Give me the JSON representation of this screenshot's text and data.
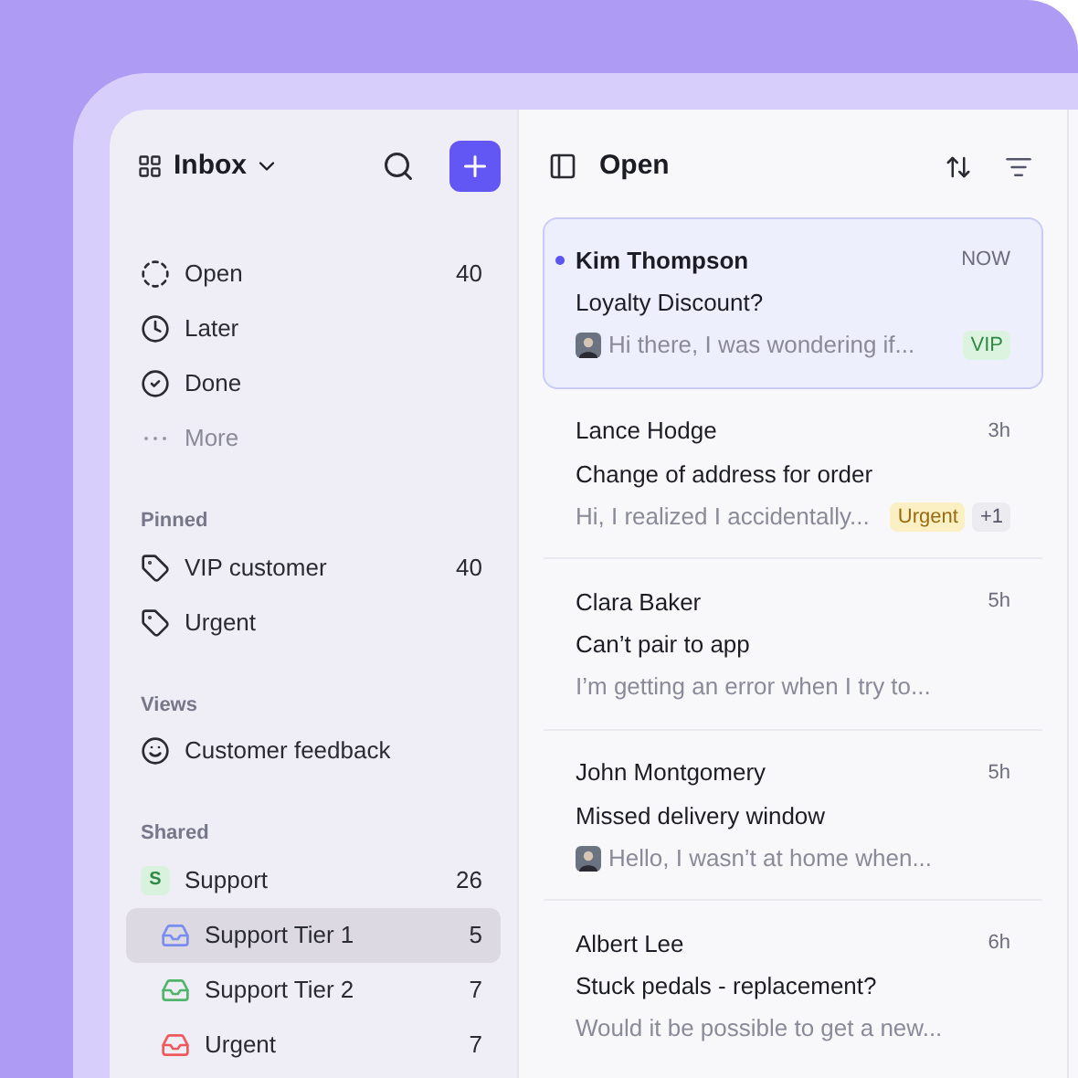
{
  "sidebar": {
    "title": "Inbox",
    "sections": [
      {
        "items": [
          {
            "kind": "open",
            "label": "Open",
            "count": "40",
            "selected": false
          },
          {
            "kind": "later",
            "label": "Later",
            "selected": false
          },
          {
            "kind": "done",
            "label": "Done",
            "selected": false
          },
          {
            "kind": "more",
            "label": "More",
            "selected": false
          }
        ]
      },
      {
        "title": "Pinned",
        "items": [
          {
            "kind": "tag",
            "label": "VIP customer",
            "count": "40",
            "selected": false
          },
          {
            "kind": "tag",
            "label": "Urgent",
            "selected": false
          }
        ]
      },
      {
        "title": "Views",
        "items": [
          {
            "kind": "view",
            "label": "Customer feedback",
            "selected": false
          }
        ]
      },
      {
        "title": "Shared",
        "items": [
          {
            "kind": "team",
            "badge": "S",
            "label": "Support",
            "count": "26",
            "selected": false,
            "children": [
              {
                "kind": "inbox",
                "color": "#7b8cf0",
                "label": "Support Tier 1",
                "count": "5",
                "selected": true
              },
              {
                "kind": "inbox",
                "color": "#4fb56a",
                "label": "Support Tier 2",
                "count": "7",
                "selected": false
              },
              {
                "kind": "inbox",
                "color": "#ee5a5a",
                "label": "Urgent",
                "count": "7",
                "selected": false
              }
            ]
          }
        ]
      }
    ]
  },
  "list": {
    "title": "Open",
    "messages": [
      {
        "sender": "Kim Thompson",
        "time": "NOW",
        "subject": "Loyalty Discount?",
        "preview": "Hi there, I was wondering if...",
        "unread": true,
        "selected": true,
        "avatar": true,
        "tags": [
          {
            "label": "VIP",
            "color": "#dcf3df"
          }
        ]
      },
      {
        "sender": "Lance Hodge",
        "time": "3h",
        "subject": "Change of address for order",
        "preview": "Hi, I realized I accidentally...",
        "unread": false,
        "selected": false,
        "avatar": false,
        "tags": [
          {
            "label": "Urgent",
            "color": "#fbefc4"
          },
          {
            "label": "+1",
            "color": "#ececf0"
          }
        ]
      },
      {
        "sender": "Clara Baker",
        "time": "5h",
        "subject": "Can’t pair to app",
        "preview": "I’m getting an error when I try to...",
        "unread": false,
        "selected": false,
        "avatar": false
      },
      {
        "sender": "John Montgomery",
        "time": "5h",
        "subject": "Missed delivery window",
        "preview": "Hello, I wasn’t at home when...",
        "unread": false,
        "selected": false,
        "avatar": true
      },
      {
        "sender": "Albert Lee",
        "time": "6h",
        "subject": "Stuck pedals - replacement?",
        "preview": "Would it be possible to get a new...",
        "unread": false,
        "selected": false,
        "avatar": false
      }
    ]
  }
}
